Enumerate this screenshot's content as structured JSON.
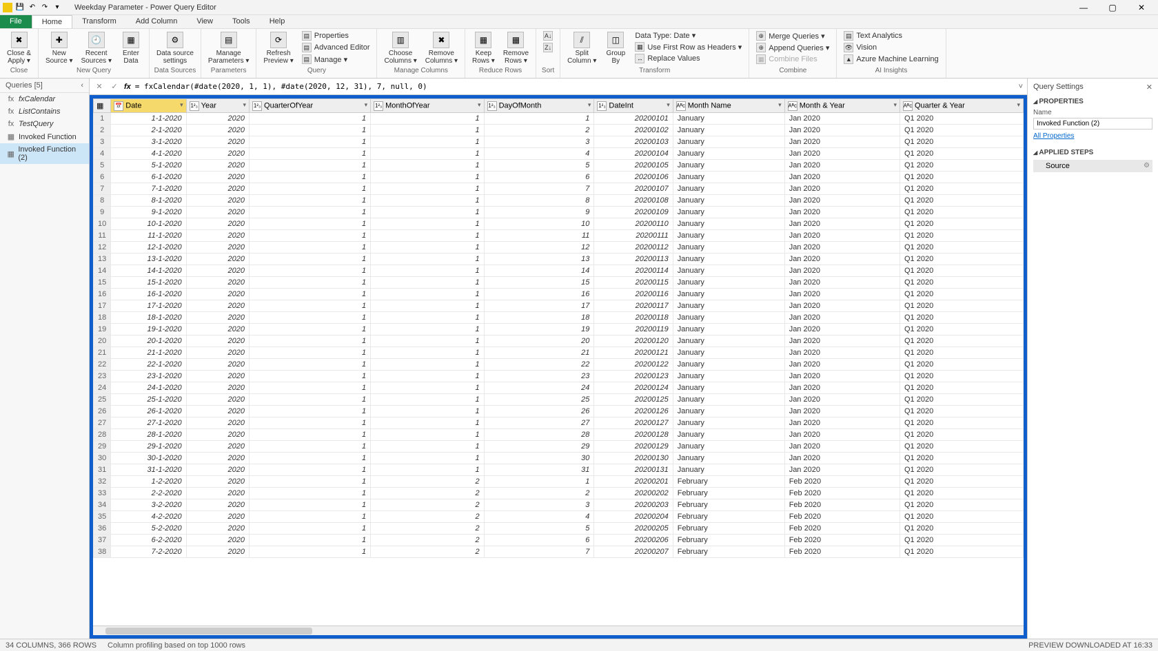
{
  "title": "Weekday Parameter - Power Query Editor",
  "menu": {
    "file": "File",
    "home": "Home",
    "transform": "Transform",
    "addColumn": "Add Column",
    "view": "View",
    "tools": "Tools",
    "help": "Help"
  },
  "ribbon": {
    "close": {
      "closeApply": "Close &\nApply ▾",
      "group": "Close"
    },
    "newQuery": {
      "newSource": "New\nSource ▾",
      "recentSources": "Recent\nSources ▾",
      "enterData": "Enter\nData",
      "group": "New Query"
    },
    "dataSources": {
      "dataSourceSettings": "Data source\nsettings",
      "group": "Data Sources"
    },
    "parameters": {
      "manageParameters": "Manage\nParameters ▾",
      "group": "Parameters"
    },
    "query": {
      "refreshPreview": "Refresh\nPreview ▾",
      "properties": "Properties",
      "advancedEditor": "Advanced Editor",
      "manage": "Manage ▾",
      "group": "Query"
    },
    "manageColumns": {
      "chooseColumns": "Choose\nColumns ▾",
      "removeColumns": "Remove\nColumns ▾",
      "group": "Manage Columns"
    },
    "reduceRows": {
      "keepRows": "Keep\nRows ▾",
      "removeRows": "Remove\nRows ▾",
      "group": "Reduce Rows"
    },
    "sort": {
      "group": "Sort"
    },
    "transform": {
      "splitColumn": "Split\nColumn ▾",
      "groupBy": "Group\nBy",
      "dataType": "Data Type: Date ▾",
      "firstRow": "Use First Row as Headers ▾",
      "replaceValues": "Replace Values",
      "group": "Transform"
    },
    "combine": {
      "mergeQueries": "Merge Queries ▾",
      "appendQueries": "Append Queries ▾",
      "combineFiles": "Combine Files",
      "group": "Combine"
    },
    "ai": {
      "textAnalytics": "Text Analytics",
      "vision": "Vision",
      "azureML": "Azure Machine Learning",
      "group": "AI Insights"
    }
  },
  "queriesPane": {
    "header": "Queries [5]",
    "items": [
      {
        "icon": "fx",
        "label": "fxCalendar"
      },
      {
        "icon": "fx",
        "label": "ListContains"
      },
      {
        "icon": "fx",
        "label": "TestQuery"
      },
      {
        "icon": "▦",
        "label": "Invoked Function"
      },
      {
        "icon": "▦",
        "label": "Invoked Function (2)"
      }
    ]
  },
  "formula": "= fxCalendar(#date(2020, 1, 1), #date(2020, 12, 31), 7, null, 0)",
  "columns": [
    {
      "type": "📅",
      "name": "Date"
    },
    {
      "type": "1²₃",
      "name": "Year"
    },
    {
      "type": "1²₃",
      "name": "QuarterOfYear"
    },
    {
      "type": "1²₃",
      "name": "MonthOfYear"
    },
    {
      "type": "1²₃",
      "name": "DayOfMonth"
    },
    {
      "type": "1²₃",
      "name": "DateInt"
    },
    {
      "type": "Aᴮc",
      "name": "Month Name"
    },
    {
      "type": "Aᴮc",
      "name": "Month & Year"
    },
    {
      "type": "Aᴮc",
      "name": "Quarter & Year"
    }
  ],
  "rows": [
    [
      "1-1-2020",
      "2020",
      "1",
      "1",
      "1",
      "20200101",
      "January",
      "Jan 2020",
      "Q1 2020"
    ],
    [
      "2-1-2020",
      "2020",
      "1",
      "1",
      "2",
      "20200102",
      "January",
      "Jan 2020",
      "Q1 2020"
    ],
    [
      "3-1-2020",
      "2020",
      "1",
      "1",
      "3",
      "20200103",
      "January",
      "Jan 2020",
      "Q1 2020"
    ],
    [
      "4-1-2020",
      "2020",
      "1",
      "1",
      "4",
      "20200104",
      "January",
      "Jan 2020",
      "Q1 2020"
    ],
    [
      "5-1-2020",
      "2020",
      "1",
      "1",
      "5",
      "20200105",
      "January",
      "Jan 2020",
      "Q1 2020"
    ],
    [
      "6-1-2020",
      "2020",
      "1",
      "1",
      "6",
      "20200106",
      "January",
      "Jan 2020",
      "Q1 2020"
    ],
    [
      "7-1-2020",
      "2020",
      "1",
      "1",
      "7",
      "20200107",
      "January",
      "Jan 2020",
      "Q1 2020"
    ],
    [
      "8-1-2020",
      "2020",
      "1",
      "1",
      "8",
      "20200108",
      "January",
      "Jan 2020",
      "Q1 2020"
    ],
    [
      "9-1-2020",
      "2020",
      "1",
      "1",
      "9",
      "20200109",
      "January",
      "Jan 2020",
      "Q1 2020"
    ],
    [
      "10-1-2020",
      "2020",
      "1",
      "1",
      "10",
      "20200110",
      "January",
      "Jan 2020",
      "Q1 2020"
    ],
    [
      "11-1-2020",
      "2020",
      "1",
      "1",
      "11",
      "20200111",
      "January",
      "Jan 2020",
      "Q1 2020"
    ],
    [
      "12-1-2020",
      "2020",
      "1",
      "1",
      "12",
      "20200112",
      "January",
      "Jan 2020",
      "Q1 2020"
    ],
    [
      "13-1-2020",
      "2020",
      "1",
      "1",
      "13",
      "20200113",
      "January",
      "Jan 2020",
      "Q1 2020"
    ],
    [
      "14-1-2020",
      "2020",
      "1",
      "1",
      "14",
      "20200114",
      "January",
      "Jan 2020",
      "Q1 2020"
    ],
    [
      "15-1-2020",
      "2020",
      "1",
      "1",
      "15",
      "20200115",
      "January",
      "Jan 2020",
      "Q1 2020"
    ],
    [
      "16-1-2020",
      "2020",
      "1",
      "1",
      "16",
      "20200116",
      "January",
      "Jan 2020",
      "Q1 2020"
    ],
    [
      "17-1-2020",
      "2020",
      "1",
      "1",
      "17",
      "20200117",
      "January",
      "Jan 2020",
      "Q1 2020"
    ],
    [
      "18-1-2020",
      "2020",
      "1",
      "1",
      "18",
      "20200118",
      "January",
      "Jan 2020",
      "Q1 2020"
    ],
    [
      "19-1-2020",
      "2020",
      "1",
      "1",
      "19",
      "20200119",
      "January",
      "Jan 2020",
      "Q1 2020"
    ],
    [
      "20-1-2020",
      "2020",
      "1",
      "1",
      "20",
      "20200120",
      "January",
      "Jan 2020",
      "Q1 2020"
    ],
    [
      "21-1-2020",
      "2020",
      "1",
      "1",
      "21",
      "20200121",
      "January",
      "Jan 2020",
      "Q1 2020"
    ],
    [
      "22-1-2020",
      "2020",
      "1",
      "1",
      "22",
      "20200122",
      "January",
      "Jan 2020",
      "Q1 2020"
    ],
    [
      "23-1-2020",
      "2020",
      "1",
      "1",
      "23",
      "20200123",
      "January",
      "Jan 2020",
      "Q1 2020"
    ],
    [
      "24-1-2020",
      "2020",
      "1",
      "1",
      "24",
      "20200124",
      "January",
      "Jan 2020",
      "Q1 2020"
    ],
    [
      "25-1-2020",
      "2020",
      "1",
      "1",
      "25",
      "20200125",
      "January",
      "Jan 2020",
      "Q1 2020"
    ],
    [
      "26-1-2020",
      "2020",
      "1",
      "1",
      "26",
      "20200126",
      "January",
      "Jan 2020",
      "Q1 2020"
    ],
    [
      "27-1-2020",
      "2020",
      "1",
      "1",
      "27",
      "20200127",
      "January",
      "Jan 2020",
      "Q1 2020"
    ],
    [
      "28-1-2020",
      "2020",
      "1",
      "1",
      "28",
      "20200128",
      "January",
      "Jan 2020",
      "Q1 2020"
    ],
    [
      "29-1-2020",
      "2020",
      "1",
      "1",
      "29",
      "20200129",
      "January",
      "Jan 2020",
      "Q1 2020"
    ],
    [
      "30-1-2020",
      "2020",
      "1",
      "1",
      "30",
      "20200130",
      "January",
      "Jan 2020",
      "Q1 2020"
    ],
    [
      "31-1-2020",
      "2020",
      "1",
      "1",
      "31",
      "20200131",
      "January",
      "Jan 2020",
      "Q1 2020"
    ],
    [
      "1-2-2020",
      "2020",
      "1",
      "2",
      "1",
      "20200201",
      "February",
      "Feb 2020",
      "Q1 2020"
    ],
    [
      "2-2-2020",
      "2020",
      "1",
      "2",
      "2",
      "20200202",
      "February",
      "Feb 2020",
      "Q1 2020"
    ],
    [
      "3-2-2020",
      "2020",
      "1",
      "2",
      "3",
      "20200203",
      "February",
      "Feb 2020",
      "Q1 2020"
    ],
    [
      "4-2-2020",
      "2020",
      "1",
      "2",
      "4",
      "20200204",
      "February",
      "Feb 2020",
      "Q1 2020"
    ],
    [
      "5-2-2020",
      "2020",
      "1",
      "2",
      "5",
      "20200205",
      "February",
      "Feb 2020",
      "Q1 2020"
    ],
    [
      "6-2-2020",
      "2020",
      "1",
      "2",
      "6",
      "20200206",
      "February",
      "Feb 2020",
      "Q1 2020"
    ],
    [
      "7-2-2020",
      "2020",
      "1",
      "2",
      "7",
      "20200207",
      "February",
      "Feb 2020",
      "Q1 2020"
    ]
  ],
  "settings": {
    "header": "Query Settings",
    "properties": "PROPERTIES",
    "nameLabel": "Name",
    "nameValue": "Invoked Function (2)",
    "allProperties": "All Properties",
    "appliedSteps": "APPLIED STEPS",
    "steps": [
      "Source"
    ]
  },
  "status": {
    "left1": "34 COLUMNS, 366 ROWS",
    "left2": "Column profiling based on top 1000 rows",
    "right": "PREVIEW DOWNLOADED AT 16:33"
  }
}
